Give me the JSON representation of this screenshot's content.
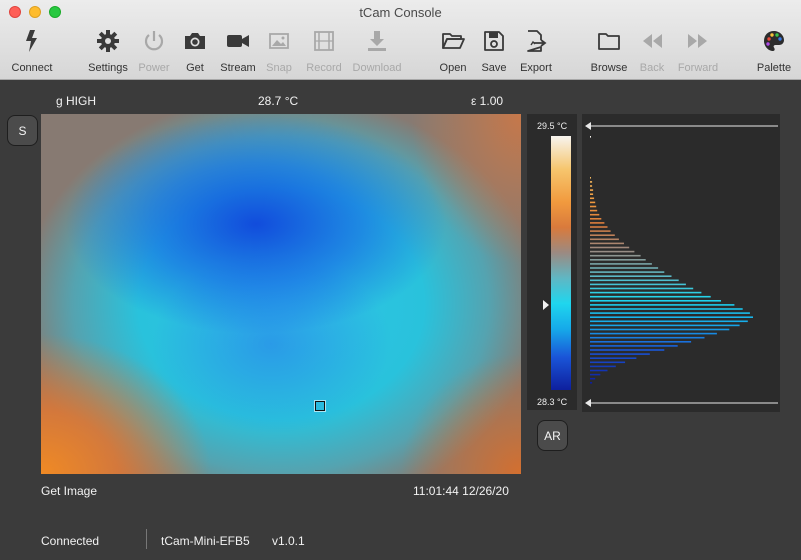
{
  "window": {
    "title": "tCam Console"
  },
  "toolbar": [
    {
      "name": "connect-button",
      "icon": "connect-icon",
      "label": "Connect",
      "enabled": true
    },
    {
      "name": "settings-button",
      "icon": "gear-icon",
      "label": "Settings",
      "enabled": true
    },
    {
      "name": "power-button",
      "icon": "power-icon",
      "label": "Power",
      "enabled": false
    },
    {
      "name": "get-button",
      "icon": "camera-icon",
      "label": "Get",
      "enabled": true
    },
    {
      "name": "stream-button",
      "icon": "video-icon",
      "label": "Stream",
      "enabled": true
    },
    {
      "name": "snap-button",
      "icon": "photo-icon",
      "label": "Snap",
      "enabled": false
    },
    {
      "name": "record-button",
      "icon": "film-icon",
      "label": "Record",
      "enabled": false
    },
    {
      "name": "download-button",
      "icon": "download-icon",
      "label": "Download",
      "enabled": false
    },
    {
      "name": "open-button",
      "icon": "folder-open-icon",
      "label": "Open",
      "enabled": true
    },
    {
      "name": "save-button",
      "icon": "floppy-icon",
      "label": "Save",
      "enabled": true
    },
    {
      "name": "export-button",
      "icon": "export-icon",
      "label": "Export",
      "enabled": true
    },
    {
      "name": "browse-button",
      "icon": "folder-icon",
      "label": "Browse",
      "enabled": true
    },
    {
      "name": "back-button",
      "icon": "rewind-icon",
      "label": "Back",
      "enabled": false
    },
    {
      "name": "forward-button",
      "icon": "fast-forward-icon",
      "label": "Forward",
      "enabled": false
    },
    {
      "name": "palette-button",
      "icon": "palette-icon",
      "label": "Palette",
      "enabled": true
    }
  ],
  "image_header": {
    "gain": "g HIGH",
    "spot_temp": "28.7 °C",
    "emissivity": "ε 1.00"
  },
  "side_buttons": {
    "s": "S",
    "ar": "AR"
  },
  "palette": {
    "max_label": "29.5 °C",
    "min_label": "28.3 °C",
    "marker_value": 28.7
  },
  "histogram": {
    "counts": [
      1,
      0,
      0,
      0,
      0,
      0,
      0,
      0,
      0,
      0,
      1,
      2,
      2,
      3,
      3,
      4,
      5,
      6,
      7,
      9,
      11,
      14,
      17,
      20,
      24,
      28,
      33,
      38,
      43,
      49,
      54,
      60,
      66,
      72,
      79,
      86,
      93,
      100,
      108,
      117,
      127,
      140,
      148,
      155,
      158,
      153,
      145,
      135,
      123,
      111,
      98,
      85,
      72,
      58,
      45,
      34,
      25,
      17,
      10,
      5,
      2
    ]
  },
  "footer": {
    "last_action": "Get Image",
    "timestamp": "11:01:44 12/26/20",
    "status": "Connected",
    "device": "tCam-Mini-EFB5",
    "version": "v1.0.1"
  },
  "colors": {
    "background": "#3b3b3b",
    "panel": "#2b2b2b",
    "toolbar": "#e0e0e0"
  }
}
